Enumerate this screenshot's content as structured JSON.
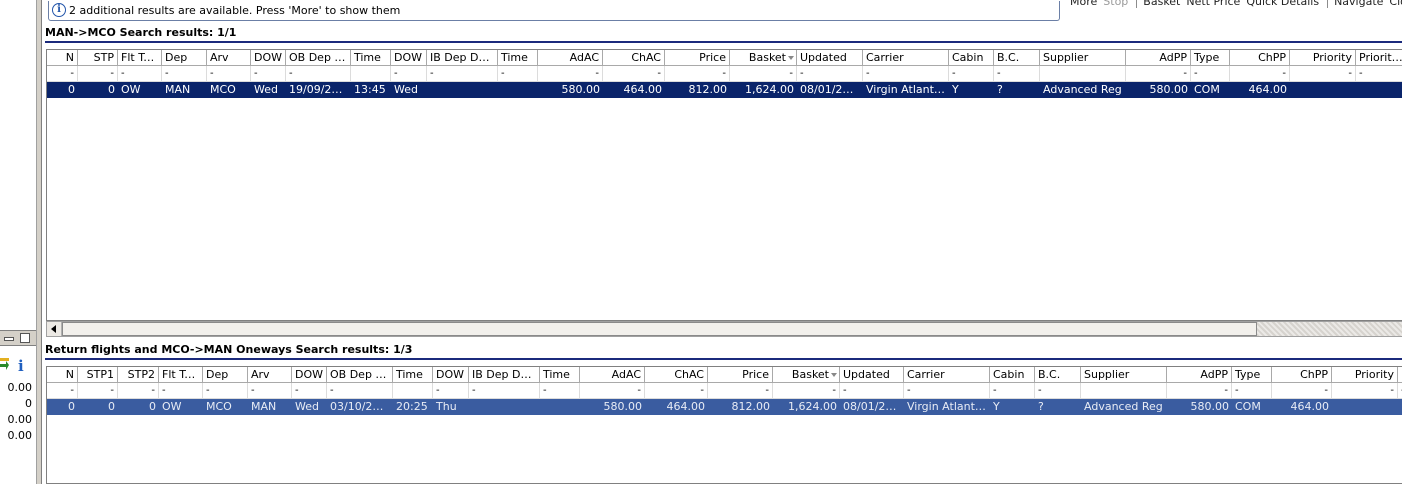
{
  "info_bar": {
    "message": "2 additional results are available. Press 'More' to show them"
  },
  "toolbar": {
    "items": [
      {
        "label": "More",
        "enabled": true
      },
      {
        "label": "Stop",
        "enabled": false
      },
      {
        "label": "Basket",
        "enabled": true
      },
      {
        "label": "Nett Price",
        "enabled": true
      },
      {
        "label": "Quick Details",
        "enabled": true
      },
      {
        "label": "Navigate",
        "enabled": true
      },
      {
        "label": "Close",
        "enabled": true
      }
    ]
  },
  "left_panel": {
    "values": [
      "0.00",
      "0",
      "0.00",
      "0.00"
    ],
    "info_glyph": "i"
  },
  "outbound": {
    "title": "MAN->MCO Search results: 1/1",
    "columns": [
      "N",
      "STP",
      "Flt Type",
      "Dep",
      "Arv",
      "DOW",
      "OB Dep D...",
      "Time",
      "DOW",
      "IB Dep Date",
      "Time",
      "AdAC",
      "ChAC",
      "Price",
      "Basket",
      "Updated",
      "Carrier",
      "Cabin",
      "B.C.",
      "Supplier",
      "AdPP",
      "Type",
      "ChPP",
      "Priority",
      "Priority de"
    ],
    "filter": [
      "-",
      "-",
      "-",
      "-",
      "-",
      "-",
      "-",
      "",
      "-",
      "-",
      "-",
      "-",
      "-",
      "-",
      "-",
      "-",
      "-",
      "-",
      "-",
      "",
      "-",
      "-",
      "-",
      "-",
      "-"
    ],
    "rows": [
      [
        "0",
        "0",
        "OW",
        "MAN",
        "MCO",
        "Wed",
        "19/09/2018",
        "13:45",
        "Wed",
        "",
        "",
        "580.00",
        "464.00",
        "812.00",
        "1,624.00",
        "08/01/2017",
        "Virgin Atlantic...",
        "Y",
        "?",
        "Advanced Reg",
        "580.00",
        "COM",
        "464.00",
        "",
        ""
      ]
    ]
  },
  "return": {
    "title": "Return flights and MCO->MAN Oneways Search results: 1/3",
    "columns": [
      "N",
      "STP1",
      "STP2",
      "Flt Type",
      "Dep",
      "Arv",
      "DOW",
      "OB Dep D...",
      "Time",
      "DOW",
      "IB Dep Date",
      "Time",
      "AdAC",
      "ChAC",
      "Price",
      "Basket",
      "Updated",
      "Carrier",
      "Cabin",
      "B.C.",
      "Supplier",
      "AdPP",
      "Type",
      "ChPP",
      "Priority",
      "Pr"
    ],
    "filter": [
      "-",
      "-",
      "-",
      "-",
      "-",
      "-",
      "-",
      "-",
      "",
      "-",
      "-",
      "-",
      "-",
      "-",
      "-",
      "-",
      "-",
      "-",
      "-",
      "-",
      "",
      "-",
      "-",
      "-",
      "-",
      "-"
    ],
    "rows": [
      [
        "0",
        "0",
        "0",
        "OW",
        "MCO",
        "MAN",
        "Wed",
        "03/10/2018",
        "20:25",
        "Thu",
        "",
        "",
        "580.00",
        "464.00",
        "812.00",
        "1,624.00",
        "08/01/2017",
        "Virgin Atlantic...",
        "Y",
        "?",
        "Advanced Reg",
        "580.00",
        "COM",
        "464.00",
        "",
        ""
      ]
    ]
  }
}
